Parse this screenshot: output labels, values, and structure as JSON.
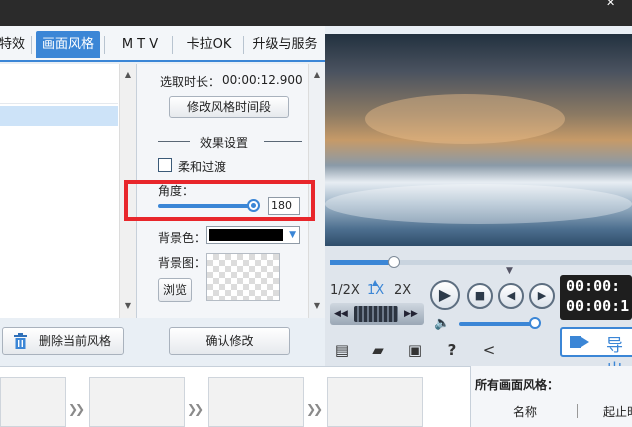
{
  "tabs": [
    {
      "label": "特效",
      "active": false
    },
    {
      "label": "画面风格",
      "active": true
    },
    {
      "label": "M T V",
      "active": false
    },
    {
      "label": "卡拉OK",
      "active": false
    },
    {
      "label": "升级与服务",
      "active": false
    }
  ],
  "window": {
    "close_glyph": "✕"
  },
  "style_panel": {
    "selected_duration_label": "选取时长：",
    "selected_duration_value": "00:00:12.900",
    "modify_segment_button": "修改风格时间段",
    "effect_settings_heading": "效果设置",
    "smooth_transition_label": "柔和过渡",
    "smooth_transition_checked": false,
    "angle_label": "角度：",
    "angle_value": "180",
    "angle_slider_fraction": 1.0,
    "bg_color_label": "背景色：",
    "bg_color_value": "#000000",
    "bg_image_label": "背景图：",
    "browse_button": "浏览",
    "confirm_button": "确认修改"
  },
  "left_panel": {
    "delete_style_button": "删除当前风格"
  },
  "player": {
    "progress_fraction": 0.2,
    "speeds": [
      {
        "label": "1/2X",
        "active": false
      },
      {
        "label": "1X",
        "active": true
      },
      {
        "label": "2X",
        "active": false
      }
    ],
    "time_current": "00:00:",
    "time_total": "00:00:1",
    "volume_fraction": 1.0,
    "export_label": "导出"
  },
  "bottom": {
    "all_styles_label": "所有画面风格：",
    "col_name": "名称",
    "col_time": "起止时"
  },
  "accent": "#3b86d6",
  "highlight_color": "#e8262b",
  "icons": [
    "new-icon",
    "open-folder-icon",
    "save-icon",
    "help-icon",
    "share-icon",
    "play-icon",
    "stop-icon",
    "prev-icon",
    "next-icon",
    "volume-icon",
    "trash-icon",
    "export-icon"
  ]
}
